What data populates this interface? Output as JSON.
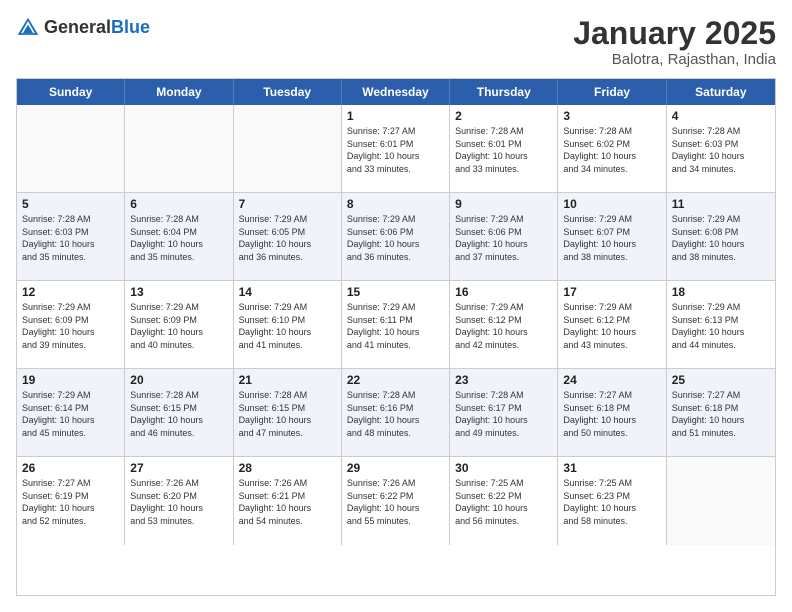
{
  "logo": {
    "general": "General",
    "blue": "Blue"
  },
  "title": {
    "main": "January 2025",
    "sub": "Balotra, Rajasthan, India"
  },
  "weekdays": [
    "Sunday",
    "Monday",
    "Tuesday",
    "Wednesday",
    "Thursday",
    "Friday",
    "Saturday"
  ],
  "weeks": [
    [
      {
        "day": "",
        "info": "",
        "empty": true
      },
      {
        "day": "",
        "info": "",
        "empty": true
      },
      {
        "day": "",
        "info": "",
        "empty": true
      },
      {
        "day": "1",
        "info": "Sunrise: 7:27 AM\nSunset: 6:01 PM\nDaylight: 10 hours\nand 33 minutes.",
        "empty": false
      },
      {
        "day": "2",
        "info": "Sunrise: 7:28 AM\nSunset: 6:01 PM\nDaylight: 10 hours\nand 33 minutes.",
        "empty": false
      },
      {
        "day": "3",
        "info": "Sunrise: 7:28 AM\nSunset: 6:02 PM\nDaylight: 10 hours\nand 34 minutes.",
        "empty": false
      },
      {
        "day": "4",
        "info": "Sunrise: 7:28 AM\nSunset: 6:03 PM\nDaylight: 10 hours\nand 34 minutes.",
        "empty": false
      }
    ],
    [
      {
        "day": "5",
        "info": "Sunrise: 7:28 AM\nSunset: 6:03 PM\nDaylight: 10 hours\nand 35 minutes.",
        "empty": false
      },
      {
        "day": "6",
        "info": "Sunrise: 7:28 AM\nSunset: 6:04 PM\nDaylight: 10 hours\nand 35 minutes.",
        "empty": false
      },
      {
        "day": "7",
        "info": "Sunrise: 7:29 AM\nSunset: 6:05 PM\nDaylight: 10 hours\nand 36 minutes.",
        "empty": false
      },
      {
        "day": "8",
        "info": "Sunrise: 7:29 AM\nSunset: 6:06 PM\nDaylight: 10 hours\nand 36 minutes.",
        "empty": false
      },
      {
        "day": "9",
        "info": "Sunrise: 7:29 AM\nSunset: 6:06 PM\nDaylight: 10 hours\nand 37 minutes.",
        "empty": false
      },
      {
        "day": "10",
        "info": "Sunrise: 7:29 AM\nSunset: 6:07 PM\nDaylight: 10 hours\nand 38 minutes.",
        "empty": false
      },
      {
        "day": "11",
        "info": "Sunrise: 7:29 AM\nSunset: 6:08 PM\nDaylight: 10 hours\nand 38 minutes.",
        "empty": false
      }
    ],
    [
      {
        "day": "12",
        "info": "Sunrise: 7:29 AM\nSunset: 6:09 PM\nDaylight: 10 hours\nand 39 minutes.",
        "empty": false
      },
      {
        "day": "13",
        "info": "Sunrise: 7:29 AM\nSunset: 6:09 PM\nDaylight: 10 hours\nand 40 minutes.",
        "empty": false
      },
      {
        "day": "14",
        "info": "Sunrise: 7:29 AM\nSunset: 6:10 PM\nDaylight: 10 hours\nand 41 minutes.",
        "empty": false
      },
      {
        "day": "15",
        "info": "Sunrise: 7:29 AM\nSunset: 6:11 PM\nDaylight: 10 hours\nand 41 minutes.",
        "empty": false
      },
      {
        "day": "16",
        "info": "Sunrise: 7:29 AM\nSunset: 6:12 PM\nDaylight: 10 hours\nand 42 minutes.",
        "empty": false
      },
      {
        "day": "17",
        "info": "Sunrise: 7:29 AM\nSunset: 6:12 PM\nDaylight: 10 hours\nand 43 minutes.",
        "empty": false
      },
      {
        "day": "18",
        "info": "Sunrise: 7:29 AM\nSunset: 6:13 PM\nDaylight: 10 hours\nand 44 minutes.",
        "empty": false
      }
    ],
    [
      {
        "day": "19",
        "info": "Sunrise: 7:29 AM\nSunset: 6:14 PM\nDaylight: 10 hours\nand 45 minutes.",
        "empty": false
      },
      {
        "day": "20",
        "info": "Sunrise: 7:28 AM\nSunset: 6:15 PM\nDaylight: 10 hours\nand 46 minutes.",
        "empty": false
      },
      {
        "day": "21",
        "info": "Sunrise: 7:28 AM\nSunset: 6:15 PM\nDaylight: 10 hours\nand 47 minutes.",
        "empty": false
      },
      {
        "day": "22",
        "info": "Sunrise: 7:28 AM\nSunset: 6:16 PM\nDaylight: 10 hours\nand 48 minutes.",
        "empty": false
      },
      {
        "day": "23",
        "info": "Sunrise: 7:28 AM\nSunset: 6:17 PM\nDaylight: 10 hours\nand 49 minutes.",
        "empty": false
      },
      {
        "day": "24",
        "info": "Sunrise: 7:27 AM\nSunset: 6:18 PM\nDaylight: 10 hours\nand 50 minutes.",
        "empty": false
      },
      {
        "day": "25",
        "info": "Sunrise: 7:27 AM\nSunset: 6:18 PM\nDaylight: 10 hours\nand 51 minutes.",
        "empty": false
      }
    ],
    [
      {
        "day": "26",
        "info": "Sunrise: 7:27 AM\nSunset: 6:19 PM\nDaylight: 10 hours\nand 52 minutes.",
        "empty": false
      },
      {
        "day": "27",
        "info": "Sunrise: 7:26 AM\nSunset: 6:20 PM\nDaylight: 10 hours\nand 53 minutes.",
        "empty": false
      },
      {
        "day": "28",
        "info": "Sunrise: 7:26 AM\nSunset: 6:21 PM\nDaylight: 10 hours\nand 54 minutes.",
        "empty": false
      },
      {
        "day": "29",
        "info": "Sunrise: 7:26 AM\nSunset: 6:22 PM\nDaylight: 10 hours\nand 55 minutes.",
        "empty": false
      },
      {
        "day": "30",
        "info": "Sunrise: 7:25 AM\nSunset: 6:22 PM\nDaylight: 10 hours\nand 56 minutes.",
        "empty": false
      },
      {
        "day": "31",
        "info": "Sunrise: 7:25 AM\nSunset: 6:23 PM\nDaylight: 10 hours\nand 58 minutes.",
        "empty": false
      },
      {
        "day": "",
        "info": "",
        "empty": true
      }
    ]
  ]
}
